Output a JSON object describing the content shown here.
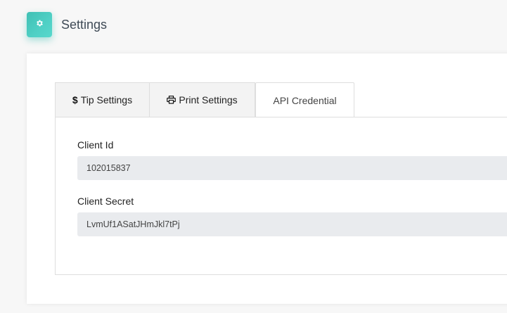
{
  "header": {
    "title": "Settings",
    "icon": "gear-icon",
    "accent_color": "#4fd0c5"
  },
  "tabs": [
    {
      "label": "Tip Settings",
      "icon": "dollar-icon",
      "active": false
    },
    {
      "label": "Print Settings",
      "icon": "printer-icon",
      "active": false
    },
    {
      "label": "API Credential",
      "icon": "",
      "active": true
    }
  ],
  "api_credential": {
    "client_id_label": "Client Id",
    "client_id_value": "102015837",
    "client_secret_label": "Client Secret",
    "client_secret_value": "LvmUf1ASatJHmJkl7tPj"
  }
}
